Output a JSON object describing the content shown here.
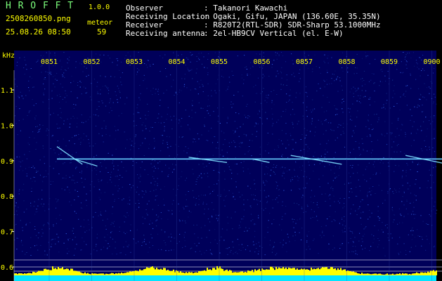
{
  "header": {
    "app_name": "H R O F F T",
    "version": "1.0.0",
    "filename": "2508260850.png",
    "datetime": "25.08.26 08:50",
    "count_label": "meteor",
    "count_value": "59",
    "info": [
      {
        "label": "Observer",
        "value": ": Takanori Kawachi"
      },
      {
        "label": "Receiving Location",
        "value": ": Ogaki, Gifu, JAPAN (136.60E, 35.35N)"
      },
      {
        "label": "Receiver",
        "value": ": R820T2(RTL-SDR) SDR-Sharp 53.1000MHz"
      },
      {
        "label": "Receiving antenna",
        "value": ": 2el-HB9CV Vertical (el. E-W)"
      }
    ]
  },
  "chart_data": {
    "type": "heatmap",
    "ylabel": "kHz",
    "x_ticks": [
      "0851",
      "0852",
      "0853",
      "0854",
      "0855",
      "0856",
      "0857",
      "0858",
      "0859",
      "0900"
    ],
    "y_ticks": [
      1.1,
      1.0,
      0.9,
      0.8,
      0.7,
      0.6
    ],
    "ylim": [
      0.58,
      1.19
    ],
    "xlim": [
      0,
      10
    ],
    "carrier_khz": 0.905,
    "echoes": [
      {
        "t0": 0.0,
        "t1": 0.6,
        "f0": 0.94,
        "f1": 0.89
      },
      {
        "t0": 0.4,
        "t1": 0.95,
        "f0": 0.905,
        "f1": 0.885
      },
      {
        "t0": 3.1,
        "t1": 4.0,
        "f0": 0.91,
        "f1": 0.895
      },
      {
        "t0": 4.6,
        "t1": 5.0,
        "f0": 0.905,
        "f1": 0.895
      },
      {
        "t0": 5.5,
        "t1": 6.7,
        "f0": 0.915,
        "f1": 0.89
      },
      {
        "t0": 8.2,
        "t1": 9.6,
        "f0": 0.915,
        "f1": 0.88
      }
    ],
    "colors": {
      "background": "#00005a",
      "carrier": "#66ccff",
      "axis_text": "#ffff00",
      "grid": "#ffffff"
    }
  }
}
